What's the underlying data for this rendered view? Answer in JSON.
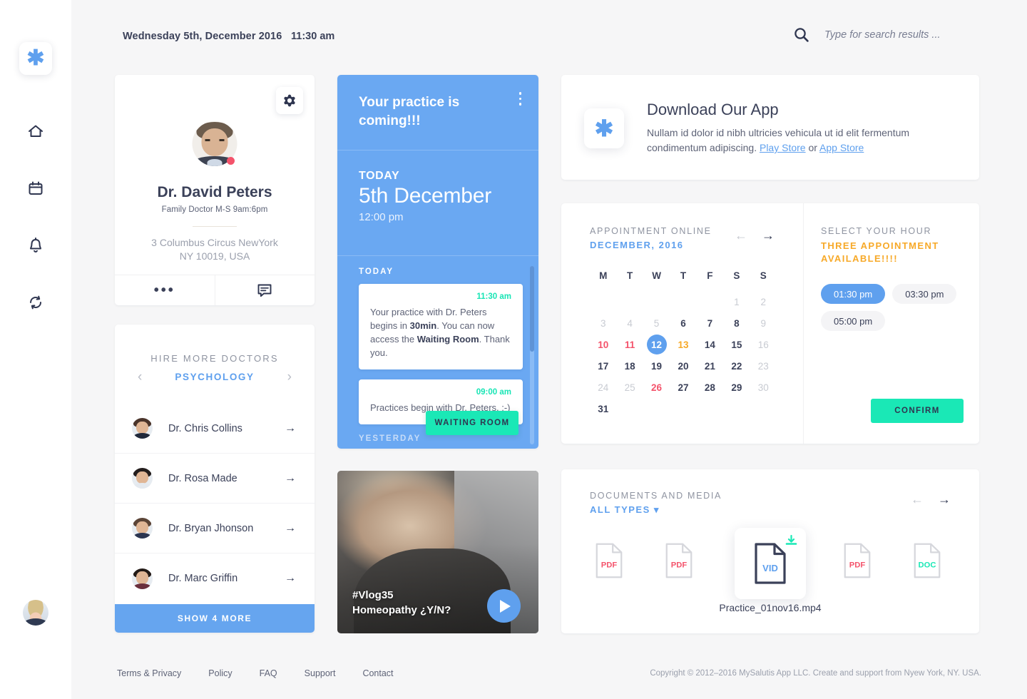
{
  "sidebar": {
    "logo_icon": "asterisk-logo",
    "items": [
      {
        "icon": "home-icon",
        "name": "home"
      },
      {
        "icon": "calendar-icon",
        "name": "calendar"
      },
      {
        "icon": "bell-icon",
        "name": "notifications"
      },
      {
        "icon": "sync-icon",
        "name": "sync"
      }
    ],
    "avatar": "user-avatar"
  },
  "topbar": {
    "date": "Wednesday 5th, December 2016",
    "time": "11:30 am",
    "search_icon": "search-icon",
    "search_placeholder": "Type for search results ...",
    "search_value": ""
  },
  "profile": {
    "gear_icon": "gear-icon",
    "name": "Dr. David Peters",
    "role": "Family Doctor M-S 9am:6pm",
    "address_line1": "3 Columbus Circus NewYork",
    "address_line2": "NY 10019, USA",
    "more_icon": "more-dots-icon",
    "message_icon": "message-icon",
    "status": "online"
  },
  "hire": {
    "title": "HIRE MORE DOCTORS",
    "category": "PSYCHOLOGY",
    "prev_icon": "chevron-left-icon",
    "next_icon": "chevron-right-icon",
    "doctors": [
      {
        "name": "Dr. Chris Collins"
      },
      {
        "name": "Dr. Rosa Made"
      },
      {
        "name": "Dr. Bryan Jhonson"
      },
      {
        "name": "Dr. Marc Griffin"
      }
    ],
    "show_more": "SHOW 4 MORE"
  },
  "practice": {
    "headline": "Your practice is coming!!!",
    "menu_icon": "kebab-menu-icon",
    "today_label": "TODAY",
    "date": "5th December",
    "time": "12:00 pm",
    "messages_day_today": "TODAY",
    "messages_day_yesterday": "YESTERDAY",
    "messages": [
      {
        "time": "11:30 am",
        "text_1": "Your practice with Dr. Peters begins in ",
        "bold_1": "30min",
        "text_2": ". You can now access the ",
        "bold_2": "Waiting Room",
        "text_3": ". Thank you."
      },
      {
        "time": "09:00 am",
        "text_1": "Practices begin with Dr. Peters. :-)",
        "bold_1": "",
        "text_2": "",
        "bold_2": "",
        "text_3": ""
      }
    ],
    "waiting_room_button": "WAITING ROOM"
  },
  "video": {
    "tag": "#Vlog35",
    "title": "Homeopathy ¿Y/N?",
    "play_icon": "play-icon"
  },
  "download_app": {
    "icon": "asterisk-logo",
    "title": "Download Our App",
    "body_1": "Nullam id dolor id nibh ultricies vehicula ut id elit fermentum condimentum adipiscing. ",
    "link_play": "Play Store",
    "between": " or ",
    "link_app": "App Store"
  },
  "appointment": {
    "label": "APPOINTMENT ONLINE",
    "month": "DECEMBER, 2016",
    "prev_icon": "arrow-left-icon",
    "next_icon": "arrow-right-icon",
    "weekdays": [
      "M",
      "T",
      "W",
      "T",
      "F",
      "S",
      "S"
    ],
    "days": [
      {
        "d": "",
        "style": "empty"
      },
      {
        "d": "",
        "style": "empty"
      },
      {
        "d": "",
        "style": "empty"
      },
      {
        "d": "",
        "style": "empty"
      },
      {
        "d": "",
        "style": "empty"
      },
      {
        "d": "1",
        "style": "muted"
      },
      {
        "d": "2",
        "style": "muted"
      },
      {
        "d": "3",
        "style": "muted"
      },
      {
        "d": "4",
        "style": "muted"
      },
      {
        "d": "5",
        "style": "muted"
      },
      {
        "d": "6",
        "style": "normal"
      },
      {
        "d": "7",
        "style": "normal"
      },
      {
        "d": "8",
        "style": "normal"
      },
      {
        "d": "9",
        "style": "muted"
      },
      {
        "d": "10",
        "style": "red"
      },
      {
        "d": "11",
        "style": "red"
      },
      {
        "d": "12",
        "style": "sel"
      },
      {
        "d": "13",
        "style": "orange"
      },
      {
        "d": "14",
        "style": "normal"
      },
      {
        "d": "15",
        "style": "normal"
      },
      {
        "d": "16",
        "style": "muted"
      },
      {
        "d": "17",
        "style": "normal"
      },
      {
        "d": "18",
        "style": "normal"
      },
      {
        "d": "19",
        "style": "normal"
      },
      {
        "d": "20",
        "style": "normal"
      },
      {
        "d": "21",
        "style": "normal"
      },
      {
        "d": "22",
        "style": "normal"
      },
      {
        "d": "23",
        "style": "muted"
      },
      {
        "d": "24",
        "style": "muted"
      },
      {
        "d": "25",
        "style": "muted"
      },
      {
        "d": "26",
        "style": "red"
      },
      {
        "d": "27",
        "style": "normal"
      },
      {
        "d": "28",
        "style": "normal"
      },
      {
        "d": "29",
        "style": "normal"
      },
      {
        "d": "30",
        "style": "muted"
      },
      {
        "d": "31",
        "style": "normal"
      }
    ],
    "hour_label": "SELECT YOUR HOUR",
    "hour_warning": "THREE APPOINTMENT AVAILABLE!!!!",
    "hours": [
      {
        "t": "01:30 pm",
        "active": true
      },
      {
        "t": "03:30 pm",
        "active": false
      },
      {
        "t": "05:00 pm",
        "active": false
      }
    ],
    "confirm": "CONFIRM"
  },
  "documents": {
    "label": "DOCUMENTS AND MEDIA",
    "filter": "ALL TYPES",
    "filter_caret": "▾",
    "prev_icon": "arrow-left-icon",
    "next_icon": "arrow-right-icon",
    "files": [
      {
        "type": "PDF",
        "selected": false
      },
      {
        "type": "PDF",
        "selected": false
      },
      {
        "type": "VID",
        "selected": true
      },
      {
        "type": "PDF",
        "selected": false
      },
      {
        "type": "DOC",
        "selected": false
      }
    ],
    "selected_name": "Practice_01nov16.mp4",
    "download_icon": "download-icon"
  },
  "footer": {
    "links": [
      "Terms & Privacy",
      "Policy",
      "FAQ",
      "Support",
      "Contact"
    ],
    "copyright": "Copyright © 2012–2016 MySalutis App LLC. Create and support from Nyew York, NY. USA."
  },
  "colors": {
    "accent_blue": "#5fa0ee",
    "mint": "#1ae8b6",
    "orange": "#f7a928",
    "red": "#f4536b",
    "dark": "#3b4159"
  }
}
